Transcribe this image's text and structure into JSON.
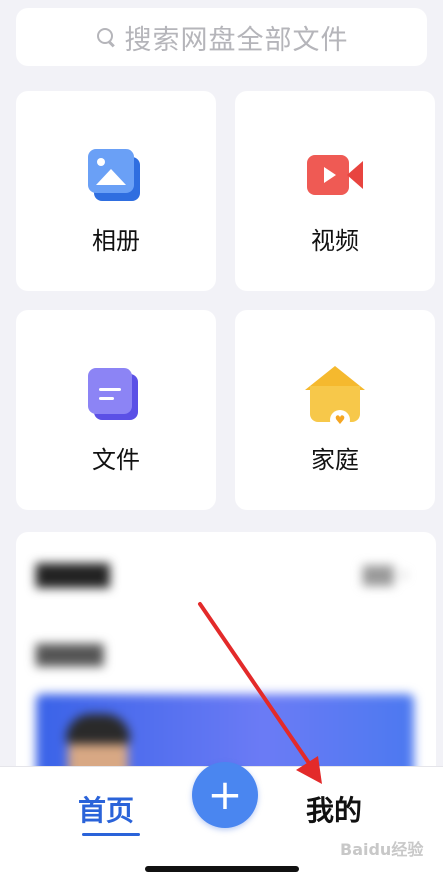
{
  "search": {
    "placeholder": "搜索网盘全部文件",
    "icon": "search-icon"
  },
  "categories": [
    {
      "label": "相册",
      "icon": "album-icon",
      "color": "#4a86f0"
    },
    {
      "label": "视频",
      "icon": "video-icon",
      "color": "#ef5a54"
    },
    {
      "label": "文件",
      "icon": "file-icon",
      "color": "#7a6ff0"
    },
    {
      "label": "家庭",
      "icon": "family-icon",
      "color": "#f5b92e"
    }
  ],
  "bottom_nav": {
    "home_label": "首页",
    "mine_label": "我的",
    "plus_icon": "plus-icon",
    "active_color": "#2a63d9"
  },
  "annotation": {
    "color": "#e32a2a"
  },
  "watermark": "Baidu经验"
}
